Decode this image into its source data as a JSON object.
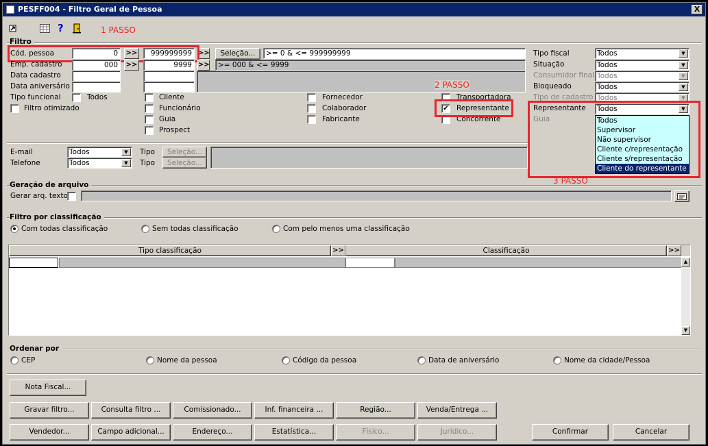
{
  "window": {
    "title": "PESFF004 - Filtro Geral de Pessoa",
    "close_label": "X"
  },
  "toolbar": {
    "icons": [
      "exit-icon",
      "grid-icon",
      "help-icon",
      "door-icon"
    ]
  },
  "annotations": {
    "step1": "1 PASSO",
    "step2": "2 PASSO",
    "step3": "3 PASSO"
  },
  "filtro": {
    "title": "Filtro",
    "cod_pessoa": {
      "label": "Cód. pessoa",
      "from": "0",
      "to": "999999999",
      "button": ">>",
      "selecao": "Seleção...",
      "expr": " >= 0 & <= 999999999"
    },
    "emp_cadastro": {
      "label": "Emp. cadastro",
      "from": "000",
      "to": "9999",
      "button": ">>",
      "expr": " >= 000 & <= 9999"
    },
    "data_cadastro": {
      "label": "Data cadastro"
    },
    "data_aniversario": {
      "label": "Data aniversário"
    },
    "tipo_funcional": {
      "label": "Tipo funcional",
      "todos": "Todos"
    },
    "filtro_otimizado": "Filtro otimizado",
    "checks_col1": [
      "Cliente",
      "Funcionário",
      "Guia",
      "Prospect"
    ],
    "checks_col2": [
      "Fornecedor",
      "Colaborador",
      "Fabricante"
    ],
    "checks_col3": [
      "Transportadora",
      "Representante",
      "Concorrente"
    ],
    "right": [
      {
        "label": "Tipo fiscal",
        "value": "Todos"
      },
      {
        "label": "Situação",
        "value": "Todos"
      },
      {
        "label": "Consumidor final",
        "value": "Todos"
      },
      {
        "label": "Bloqueado",
        "value": "Todos"
      },
      {
        "label": "Tipo de cadastro",
        "value": "Todos"
      },
      {
        "label": "Representante",
        "value": "Todos"
      },
      {
        "label": "Guia",
        "value": ""
      }
    ],
    "dropdown_options": [
      "Todos",
      "Supervisor",
      "Não supervisor",
      "Cliente c/representação",
      "Cliente s/representação",
      "Cliente do representante"
    ],
    "dropdown_selected": "Cliente do representante",
    "email": {
      "label": "E-mail",
      "value": "Todos",
      "tipo": "Tipo",
      "selecao": "Seleção..."
    },
    "telefone": {
      "label": "Telefone",
      "value": "Todos",
      "tipo": "Tipo",
      "selecao": "Seleção..."
    }
  },
  "geracao": {
    "title": "Geração de arquivo",
    "gerar_label": "Gerar arq. texto"
  },
  "classificacao": {
    "title": "Filtro por classificação",
    "radios": [
      "Com todas classificação",
      "Sem todas classificação",
      "Com pelo menos uma classificação"
    ],
    "selected": "Com todas classificação",
    "col1": "Tipo classificação",
    "col2": "Classificação",
    "expand": ">>"
  },
  "ordenar": {
    "title": "Ordenar por",
    "radios": [
      "CEP",
      "Nome da pessoa",
      "Código da pessoa",
      "Data de aniversário",
      "Nome da cidade/Pessoa"
    ]
  },
  "buttons": {
    "nota_fiscal": "Nota Fiscal...",
    "row1": [
      "Gravar filtro...",
      "Consulta filtro ...",
      "Comissionado...",
      "Inf. financeira ...",
      "Região...",
      "Venda/Entrega ..."
    ],
    "row2": [
      "Vendedor...",
      "Campo adicional...",
      "Endereço...",
      "Estatística...",
      "Físico...",
      "Jurídico..."
    ],
    "confirmar": "Confirmar",
    "cancelar": "Cancelar"
  }
}
